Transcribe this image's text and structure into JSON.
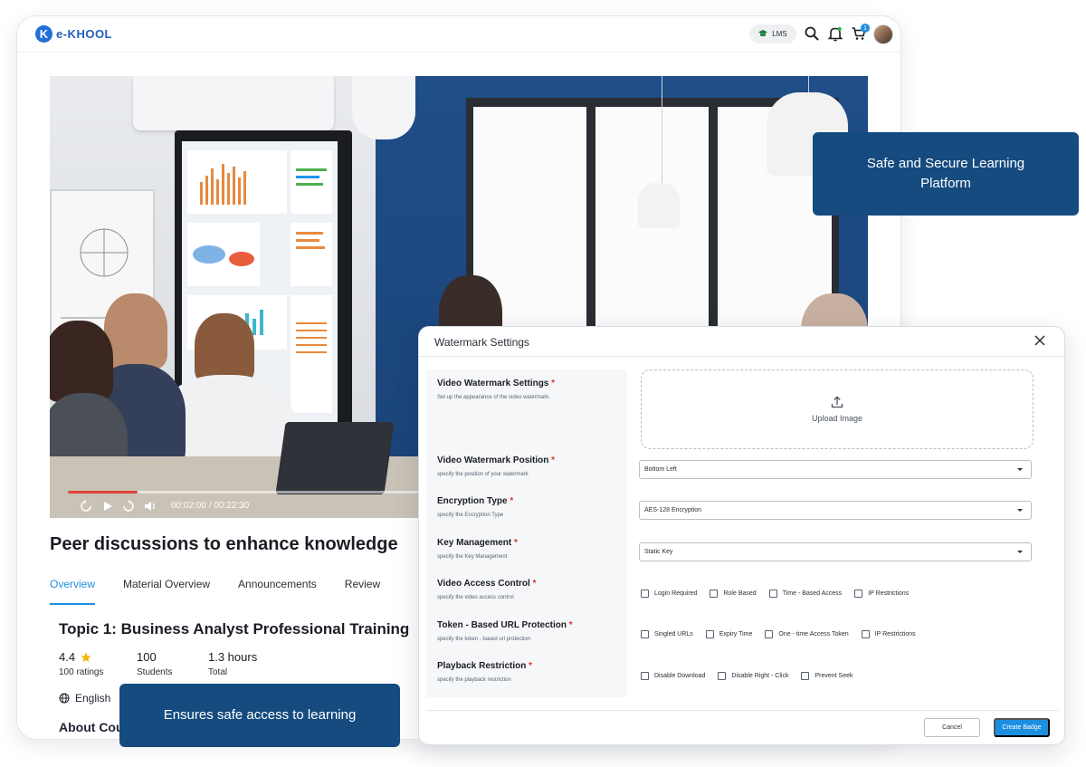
{
  "header": {
    "logo_mark": "K",
    "logo_text": "e-KHOOL",
    "lms_label": "LMS",
    "cart_count": "1"
  },
  "video": {
    "current_time": "00:02:00",
    "total_time": "00:22:30",
    "time_separator": "/",
    "progress_fraction": 0.089
  },
  "course": {
    "title": "Peer discussions to enhance knowledge",
    "tabs": [
      {
        "label": "Overview",
        "active": true
      },
      {
        "label": "Material Overview",
        "active": false
      },
      {
        "label": "Announcements",
        "active": false
      },
      {
        "label": "Review",
        "active": false
      }
    ],
    "topic_title": "Topic 1: Business Analyst Professional Training",
    "rating": "4.4",
    "ratings_label": "100 ratings",
    "students": "100",
    "students_label": "Students",
    "hours": "1.3 hours",
    "hours_label": "Total",
    "language": "English",
    "about_label": "About Cou"
  },
  "callouts": {
    "secure": "Safe and Secure Learning Platform",
    "access": "Ensures safe access to learning"
  },
  "modal": {
    "title": "Watermark Settings",
    "fields": [
      {
        "label": "Video Watermark Settings",
        "desc": "Set up the appearance of the video watermark."
      },
      {
        "label": "Video Watermark Position",
        "desc": "specify the position of your watermark"
      },
      {
        "label": "Encryption Type",
        "desc": "specify the Encryption Type"
      },
      {
        "label": "Key Management",
        "desc": "specify the Key Management"
      },
      {
        "label": "Video Access Control",
        "desc": "specify the video access control"
      },
      {
        "label": "Token - Based URL Protection",
        "desc": "specify the token - based url protection"
      },
      {
        "label": "Playback Restriction",
        "desc": "specify the playback restriction"
      }
    ],
    "required_mark": "*",
    "upload_label": "Upload Image",
    "position_value": "Bottom Left",
    "encryption_value": "AES-128 Encryption",
    "key_value": "Static Key",
    "access_options": [
      "Login Required",
      "Role Based",
      "Time - Based Access",
      "IP Restrictions"
    ],
    "token_options": [
      "Singled URLs",
      "Expiry Time",
      "One - time Access Token",
      "IP Restrictions"
    ],
    "playback_options": [
      "Disable Download",
      "Disable Right - Click",
      "Prevent Seek"
    ],
    "cancel_label": "Cancel",
    "create_label": "Create Badge"
  },
  "colors": {
    "brand_blue": "#1f5fbf",
    "accent": "#1d8fe1",
    "callout_bg": "#154b7f",
    "required": "#d9342b",
    "progress": "#e0423b"
  }
}
